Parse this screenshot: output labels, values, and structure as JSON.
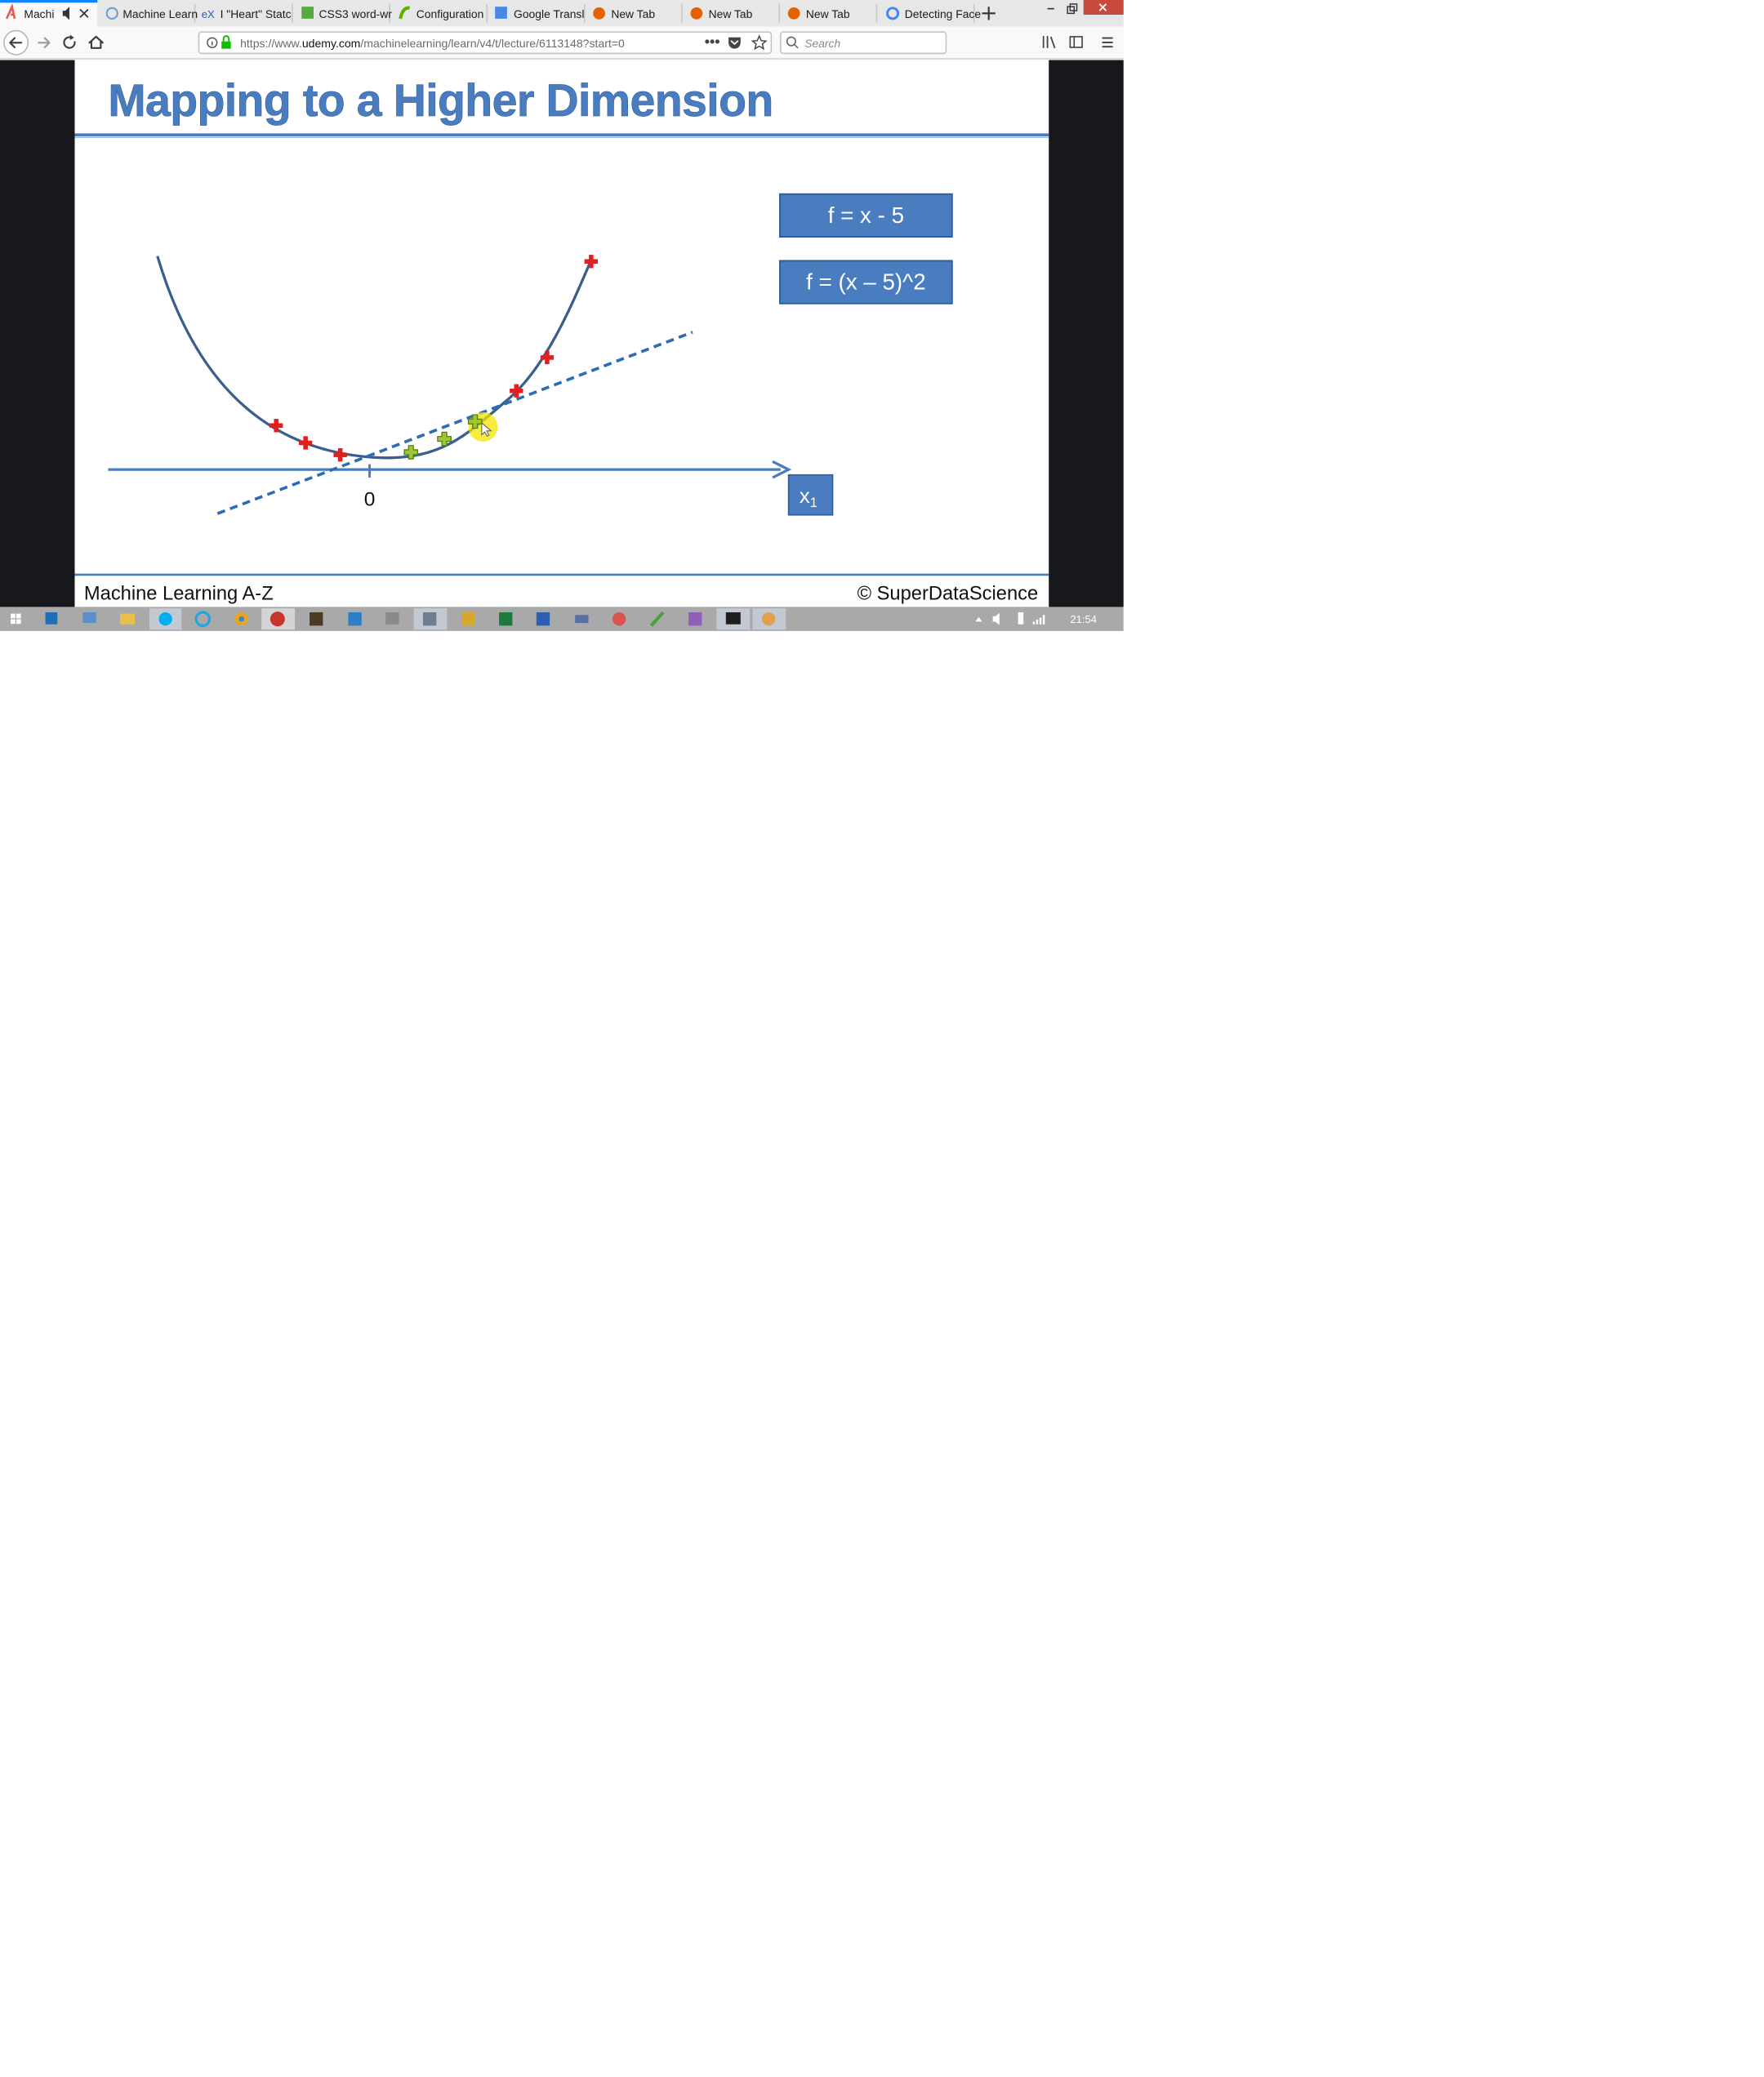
{
  "browser": {
    "tabs": [
      {
        "label": "Machi",
        "active": true
      },
      {
        "label": "Machine Learn",
        "active": false
      },
      {
        "label": "I \"Heart\" Statc",
        "active": false
      },
      {
        "label": "CSS3 word-wr",
        "active": false
      },
      {
        "label": "Configuration",
        "active": false
      },
      {
        "label": "Google Transl",
        "active": false
      },
      {
        "label": "New Tab",
        "active": false
      },
      {
        "label": "New Tab",
        "active": false
      },
      {
        "label": "New Tab",
        "active": false
      },
      {
        "label": "Detecting Face",
        "active": false
      }
    ],
    "url_prefix": "https://www.",
    "url_domain": "udemy.com",
    "url_path": "/machinelearning/learn/v4/t/lecture/6113148?start=0",
    "search_placeholder": "Search",
    "icons": [
      "back-icon",
      "forward-icon",
      "reload-icon",
      "home-icon",
      "info-icon",
      "lock-icon",
      "page-actions-icon",
      "pocket-icon",
      "bookmark-star-icon",
      "search-icon",
      "library-icon",
      "sidebar-icon",
      "menu-icon",
      "minimize-icon",
      "restore-icon",
      "close-icon",
      "new-tab-icon",
      "speaker-icon"
    ]
  },
  "slide": {
    "title": "Mapping to a Higher Dimension",
    "formula1": "f = x - 5",
    "formula2": "f = (x – 5)^2",
    "axis_label_base": "x",
    "axis_label_sub": "1",
    "origin_label": "0",
    "footer_left": "Machine Learning A-Z",
    "footer_right": "© SuperDataScience",
    "colors": {
      "title": "#4a7cc0",
      "box": "#4a7cc0",
      "curve": "#3b5e8c",
      "dashed": "#2a6db3",
      "red_point": "#e02020",
      "green_point": "#9cc92f",
      "highlight": "#f4e400"
    }
  },
  "taskbar": {
    "clock": "21:54",
    "apps": [
      "start-icon",
      "outlook-icon",
      "network-icon",
      "file-explorer-icon",
      "skype-icon",
      "ie-icon",
      "chrome-icon",
      "firefox-icon",
      "sublime-icon",
      "vscode-icon",
      "printer-icon",
      "app-icon",
      "paint-icon",
      "excel-icon",
      "word-icon",
      "app2-icon",
      "palette-icon",
      "app3-icon",
      "visual-studio-icon",
      "terminal-icon",
      "app4-icon"
    ],
    "tray": [
      "tray-arrow-icon",
      "volume-icon",
      "battery-icon",
      "signal-icon"
    ]
  }
}
